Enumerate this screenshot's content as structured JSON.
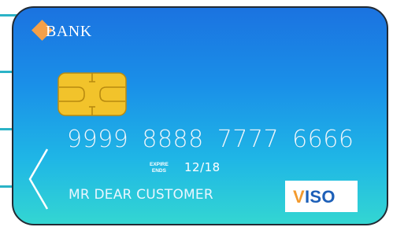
{
  "card": {
    "bank_name": "BANK",
    "number_groups": [
      "9999",
      "8888",
      "7777",
      "6666"
    ],
    "expire_label_line1": "EXPIRE",
    "expire_label_line2": "ENDS",
    "expiry_date": "12/18",
    "cardholder_name": "MR DEAR CUSTOMER",
    "brand_name": "VISO"
  },
  "icons": {
    "chip": "chip-icon",
    "arrow": "chevron-left-icon",
    "bank_logo": "diamond-icon"
  },
  "colors": {
    "card_gradient_top": "#1b73e0",
    "card_gradient_bottom": "#33d6d2",
    "logo_accent": "#f4a049",
    "chip_gold": "#f2c32b",
    "brand_blue": "#1d5fb8",
    "brand_orange": "#f39a2e",
    "edge_lines": "#2bb3c7"
  }
}
